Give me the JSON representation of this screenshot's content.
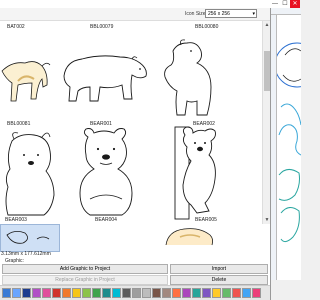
{
  "window": {
    "minimize_glyph": "—",
    "maximize_glyph": "☐",
    "close_glyph": "✕"
  },
  "toolbar": {
    "icon_size_label": "Icon Size:",
    "icon_size_value": "256 x 256"
  },
  "grid": {
    "labels": {
      "bat": "BAT002",
      "top_mid": "BBL00079",
      "top_right": "BBL00080",
      "r2c1": "BBL00081",
      "r2c2": "BEAR001",
      "r2c3": "BEAR002",
      "r3c1": "BEAR003",
      "r3c2": "BEAR004",
      "r3c3": "BEAR005"
    },
    "icons": [
      "bear-walking-icon",
      "bear-standing-icon",
      "bear-sitting-icon",
      "koala-icon"
    ]
  },
  "status": {
    "size_text": "3.13mm x 177.612mm",
    "graphic_label": "Graphic:"
  },
  "buttons": {
    "add_graphic": "Add Graphic to Project",
    "add_graphic_disabled": "Replace Graphic in Project",
    "import": "Import",
    "delete": "Delete"
  },
  "palette": {
    "colors": [
      "#3a7bd5",
      "#6aa5ff",
      "#1d3c8f",
      "#b14fc5",
      "#e04e9b",
      "#d0342c",
      "#f07a2c",
      "#f5c518",
      "#8bc34a",
      "#3fa34d",
      "#1e8c8c",
      "#00bcd4",
      "#5c5c5c",
      "#9e9e9e",
      "#bdbdbd",
      "#795548",
      "#a1887f",
      "#ff7043",
      "#ab47bc",
      "#26a69a",
      "#7e57c2",
      "#ffca28",
      "#66bb6a",
      "#ef5350",
      "#42a5f5",
      "#ec407a"
    ]
  }
}
